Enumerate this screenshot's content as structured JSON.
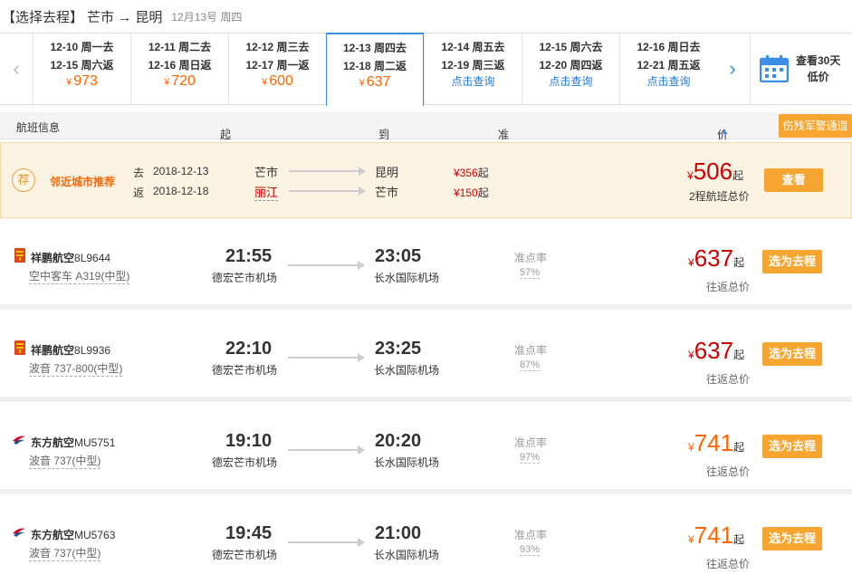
{
  "header": {
    "title": "【选择去程】",
    "route": "芒市 → 昆明",
    "date": "12月13号 周四"
  },
  "date_strip": {
    "cells": [
      {
        "d1": "12-10 周一去",
        "d2": "12-15 周六返",
        "price": "973",
        "query": ""
      },
      {
        "d1": "12-11 周二去",
        "d2": "12-16 周日返",
        "price": "720",
        "query": ""
      },
      {
        "d1": "12-12 周三去",
        "d2": "12-17 周一返",
        "price": "600",
        "query": ""
      },
      {
        "d1": "12-13 周四去",
        "d2": "12-18 周二返",
        "price": "637",
        "query": ""
      },
      {
        "d1": "12-14 周五去",
        "d2": "12-19 周三返",
        "price": "",
        "query": "点击查询"
      },
      {
        "d1": "12-15 周六去",
        "d2": "12-20 周四返",
        "price": "",
        "query": "点击查询"
      },
      {
        "d1": "12-16 周日去",
        "d2": "12-21 周五返",
        "price": "",
        "query": "点击查询"
      }
    ],
    "currency": "¥",
    "calendar_label_1": "查看30天",
    "calendar_label_2": "低价"
  },
  "columns": {
    "flight_info": "航班信息",
    "depart_time": "起飞时间",
    "arrive_time": "到达时间",
    "ontime": "准点率",
    "price": "价格",
    "military": "伤残军警通道"
  },
  "recommend": {
    "badge": "荐",
    "title": "邻近城市推荐",
    "go_tag": "去",
    "go_date": "2018-12-13",
    "go_from": "芒市",
    "go_to": "昆明",
    "go_price": "¥356",
    "back_tag": "返",
    "back_date": "2018-12-18",
    "back_from": "丽江",
    "back_to": "芒市",
    "back_price": "¥150",
    "unit": "起",
    "currency": "¥",
    "total": "506",
    "total_note": "2程航班总价",
    "view_label": "查看"
  },
  "flights": [
    {
      "airline": "祥鹏航空",
      "flight_no": "8L9644",
      "plane": "空中客车 A319(中型)",
      "dep_time": "21:55",
      "dep_airport": "德宏芒市机场",
      "arr_time": "23:05",
      "arr_airport": "长水国际机场",
      "ontime_label": "准点率",
      "ontime": "57%",
      "currency": "¥",
      "price": "637",
      "unit": "起",
      "total_note": "往返总价",
      "select_label": "选为去程"
    },
    {
      "airline": "祥鹏航空",
      "flight_no": "8L9936",
      "plane": "波音 737-800(中型)",
      "dep_time": "22:10",
      "dep_airport": "德宏芒市机场",
      "arr_time": "23:25",
      "arr_airport": "长水国际机场",
      "ontime_label": "准点率",
      "ontime": "87%",
      "currency": "¥",
      "price": "637",
      "unit": "起",
      "total_note": "往返总价",
      "select_label": "选为去程"
    },
    {
      "airline": "东方航空",
      "flight_no": "MU5751",
      "plane": "波音 737(中型)",
      "dep_time": "19:10",
      "dep_airport": "德宏芒市机场",
      "arr_time": "20:20",
      "arr_airport": "长水国际机场",
      "ontime_label": "准点率",
      "ontime": "97%",
      "currency": "¥",
      "price": "741",
      "unit": "起",
      "total_note": "往返总价",
      "select_label": "选为去程"
    },
    {
      "airline": "东方航空",
      "flight_no": "MU5763",
      "plane": "波音 737(中型)",
      "dep_time": "19:45",
      "dep_airport": "德宏芒市机场",
      "arr_time": "21:00",
      "arr_airport": "长水国际机场",
      "ontime_label": "准点率",
      "ontime": "93%",
      "currency": "¥",
      "price": "741",
      "unit": "起",
      "total_note": "往返总价",
      "select_label": "选为去程"
    }
  ],
  "colors": {
    "accent_blue": "#3a8ee6",
    "price_orange": "#ff6600",
    "price_red": "#cc0000",
    "button_orange": "#f7a531",
    "xiangpeng": "#e0461c",
    "eastern_red": "#d4001e",
    "eastern_blue": "#1b4f9c"
  }
}
